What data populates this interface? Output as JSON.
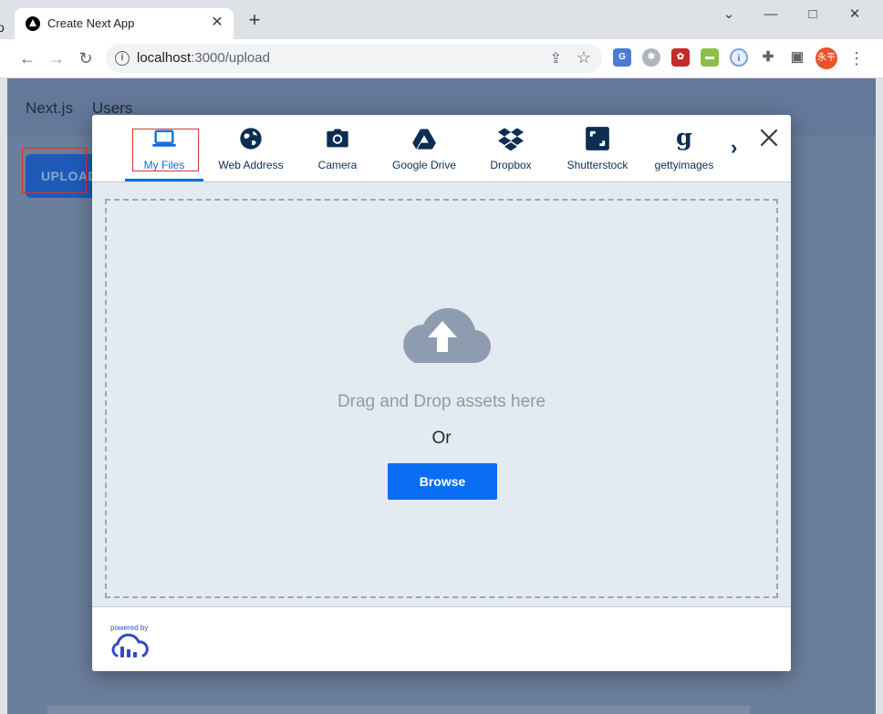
{
  "browser": {
    "tab_title": "Create Next App",
    "url_host": "localhost",
    "url_path": ":3000/upload",
    "profile_label": "永平",
    "tab_close": "✕",
    "new_tab": "+",
    "minimize": "⌄",
    "restore": "□",
    "close": "✕",
    "nav_back": "←",
    "nav_forward": "→",
    "reload": "↻"
  },
  "page": {
    "nav": {
      "brand": "Next.js",
      "users": "Users"
    },
    "upload_button": "UPLOAD"
  },
  "widget": {
    "tabs": [
      {
        "label": "My Files",
        "icon": "laptop-icon",
        "active": true
      },
      {
        "label": "Web Address",
        "icon": "globe-icon",
        "active": false
      },
      {
        "label": "Camera",
        "icon": "camera-icon",
        "active": false
      },
      {
        "label": "Google Drive",
        "icon": "google-drive-icon",
        "active": false
      },
      {
        "label": "Dropbox",
        "icon": "dropbox-icon",
        "active": false
      },
      {
        "label": "Shutterstock",
        "icon": "shutterstock-icon",
        "active": false
      },
      {
        "label": "gettyimages",
        "icon": "gettyimages-icon",
        "active": false
      }
    ],
    "next_arrow": "›",
    "drop_text": "Drag and Drop assets here",
    "or_text": "Or",
    "browse_label": "Browse",
    "powered_by": "powered by"
  },
  "colors": {
    "accent": "#0a6ef5",
    "overlay": "#6b7f9c",
    "dropzone_bg": "#e3eaf2",
    "highlight_box": "#e03131"
  }
}
